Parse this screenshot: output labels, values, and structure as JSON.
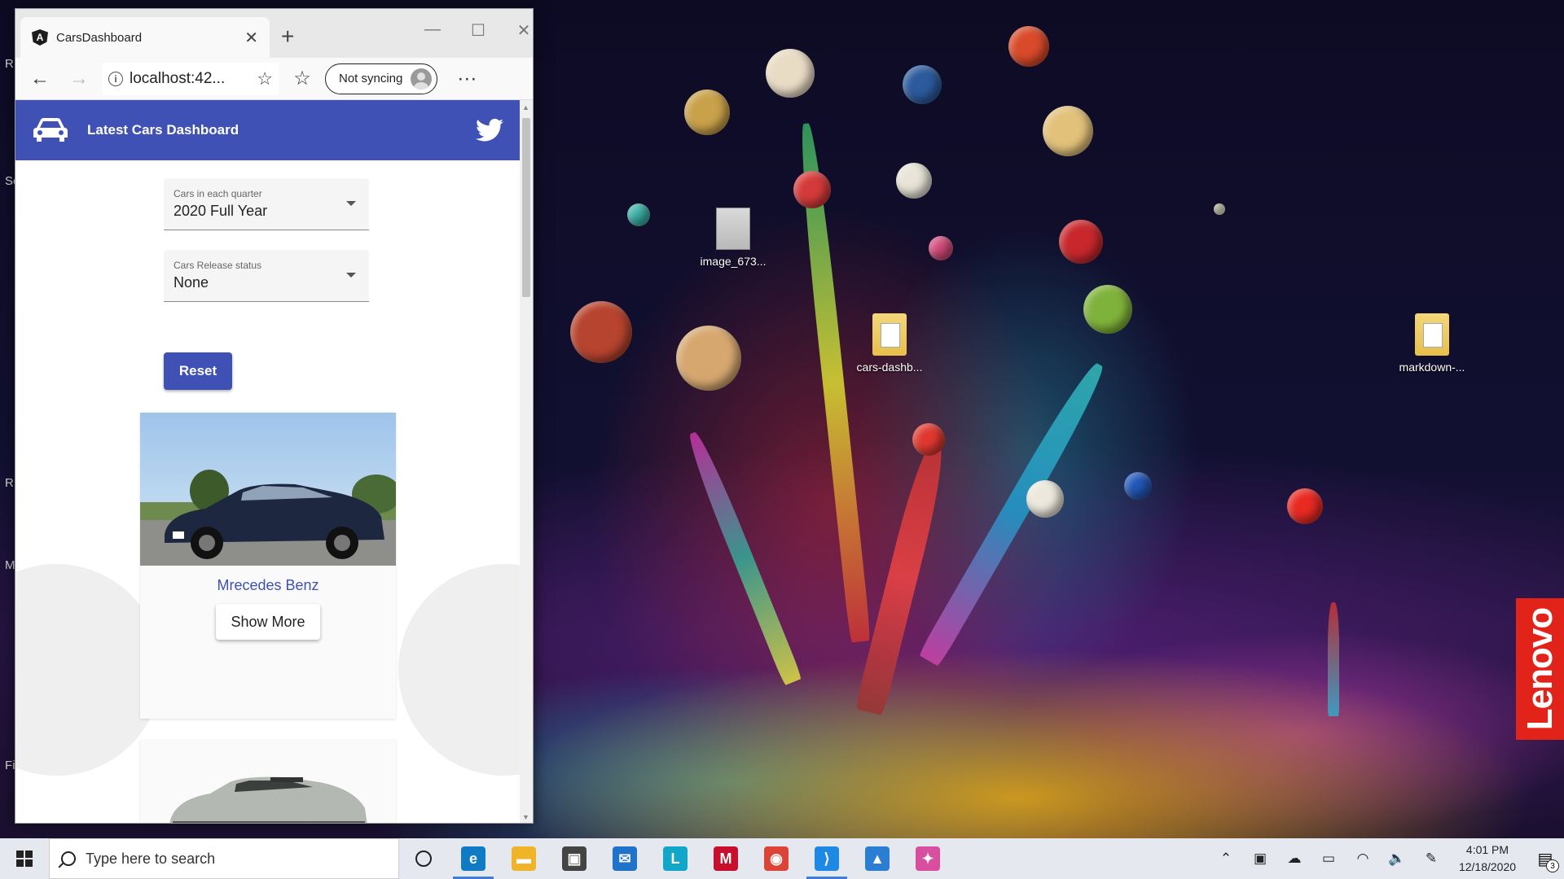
{
  "desktop": {
    "icons": [
      {
        "label": "image_673..."
      },
      {
        "label": "cars-dashb..."
      },
      {
        "label": "markdown-..."
      }
    ],
    "brand_badge": "Lenovo",
    "edge_fragments": [
      "R",
      "Se",
      "R",
      "M",
      "Fi"
    ]
  },
  "browser": {
    "tab_title": "CarsDashboard",
    "tab_close": "✕",
    "new_tab": "+",
    "window_controls": {
      "minimize": "—",
      "maximize": "☐",
      "close": "✕"
    },
    "url": "localhost:42...",
    "sync_label": "Not syncing",
    "more": "···"
  },
  "app": {
    "title": "Latest Cars Dashboard",
    "brand_color": "#3f51b5",
    "filters": [
      {
        "label": "Cars in each quarter",
        "value": "2020 Full Year"
      },
      {
        "label": "Cars Release status",
        "value": "None"
      }
    ],
    "reset_label": "Reset",
    "cards": [
      {
        "name": "Mrecedes Benz",
        "button": "Show More"
      },
      {
        "name": "",
        "button": ""
      }
    ]
  },
  "taskbar": {
    "search_placeholder": "Type here to search",
    "apps": [
      {
        "name": "edge-icon",
        "color": "#0f7bc4",
        "glyph": "e"
      },
      {
        "name": "file-explorer-icon",
        "color": "#f0b429",
        "glyph": "▬"
      },
      {
        "name": "store-icon",
        "color": "#444444",
        "glyph": "▣"
      },
      {
        "name": "mail-icon",
        "color": "#1f73c8",
        "glyph": "✉"
      },
      {
        "name": "l-app-icon",
        "color": "#12a6c9",
        "glyph": "L"
      },
      {
        "name": "mcafee-icon",
        "color": "#c8102e",
        "glyph": "M"
      },
      {
        "name": "chrome-icon",
        "color": "#db4437",
        "glyph": "◉"
      },
      {
        "name": "vscode-icon",
        "color": "#1e88e5",
        "glyph": "⟩"
      },
      {
        "name": "photos-icon",
        "color": "#2a7fd4",
        "glyph": "▲"
      },
      {
        "name": "pinwheel-icon",
        "color": "#d94fa0",
        "glyph": "✦"
      }
    ],
    "time": "4:01 PM",
    "date": "12/18/2020",
    "notification_count": "3"
  }
}
